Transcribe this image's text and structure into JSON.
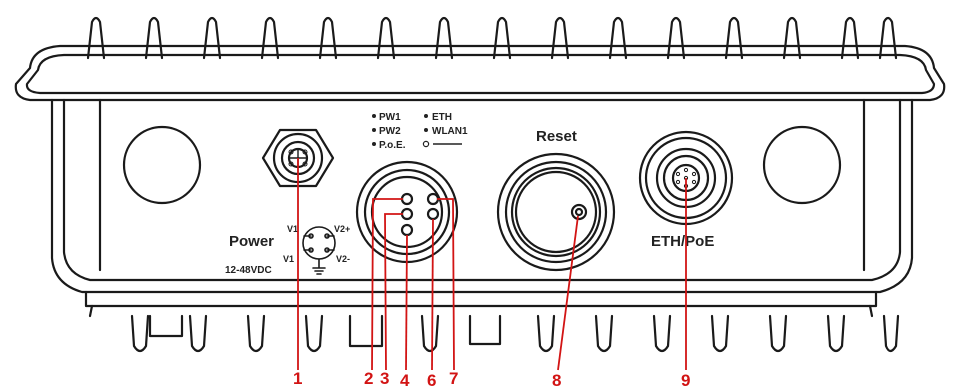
{
  "panel": {
    "led_legend": {
      "left": [
        "PW1",
        "PW2",
        "P.o.E."
      ],
      "right": [
        "ETH",
        "WLAN1"
      ]
    },
    "reset_label": "Reset",
    "power_label": "Power",
    "voltage_label": "12-48VDC",
    "pin_labels": {
      "v1_top": "V1",
      "v2_plus": "V2+",
      "v1_bottom": "V1",
      "v2_minus": "V2-"
    },
    "eth_label": "ETH/PoE"
  },
  "callouts": [
    "1",
    "2",
    "3",
    "4",
    "6",
    "7",
    "8",
    "9"
  ],
  "colors": {
    "callout": "#d21414",
    "outline": "#1a1a1a",
    "body": "#ffffff"
  }
}
